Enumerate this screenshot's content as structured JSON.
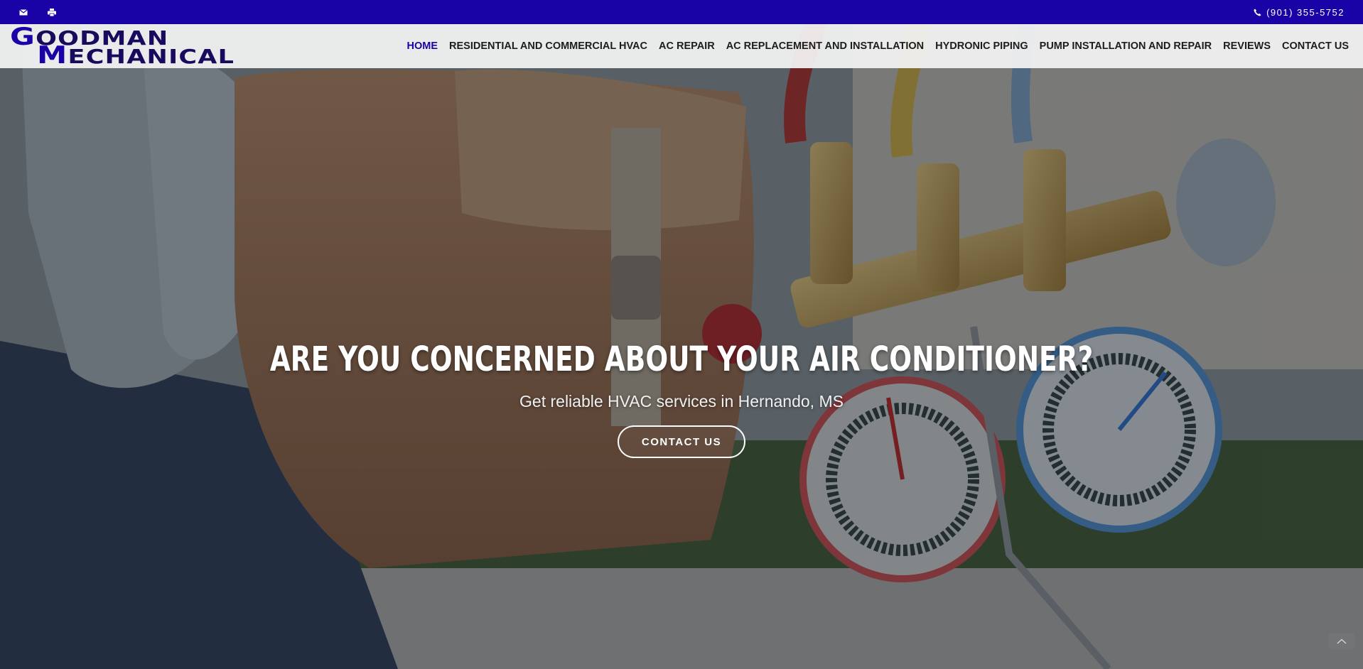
{
  "topbar": {
    "email_icon": "envelope-icon",
    "print_icon": "printer-icon",
    "phone_icon": "phone-icon",
    "phone": "(901) 355-5752"
  },
  "logo": {
    "line1_initial": "G",
    "line1_rest": "OODMAN",
    "line2_initial": "M",
    "line2_rest": "ECHANICAL"
  },
  "nav": {
    "items": [
      {
        "label": "HOME",
        "active": true
      },
      {
        "label": "RESIDENTIAL AND COMMERCIAL HVAC"
      },
      {
        "label": "AC REPAIR"
      },
      {
        "label": "AC REPLACEMENT AND INSTALLATION"
      },
      {
        "label": "HYDRONIC PIPING"
      },
      {
        "label": "PUMP INSTALLATION AND REPAIR"
      },
      {
        "label": "REVIEWS"
      },
      {
        "label": "CONTACT US"
      }
    ]
  },
  "hero": {
    "title": "ARE YOU CONCERNED ABOUT YOUR AIR CONDITIONER?",
    "subtitle": "Get reliable HVAC services in Hernando, MS",
    "cta_label": "CONTACT US"
  },
  "scroll_top_icon": "chevron-up-icon",
  "colors": {
    "brand": "#1a03a6",
    "nav_text": "#1d1d1d",
    "header_bg": "#f4f4f4"
  }
}
